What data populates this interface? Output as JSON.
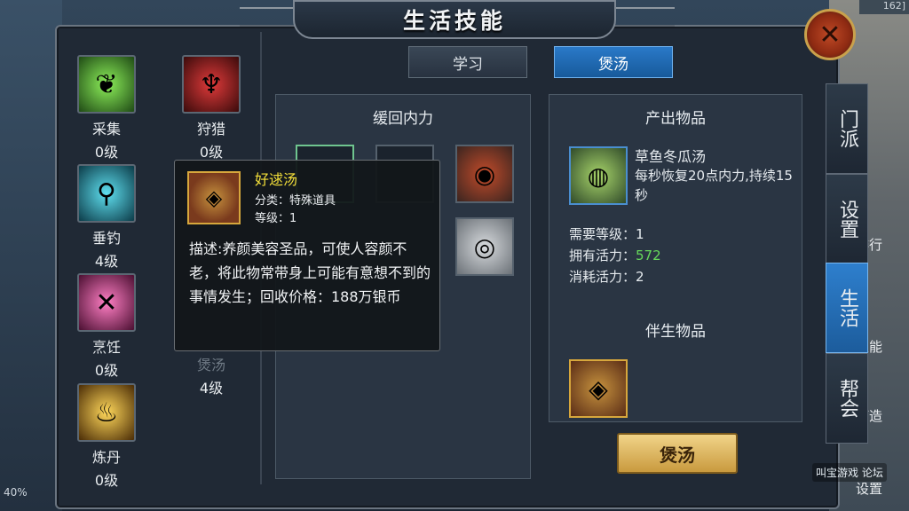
{
  "window": {
    "title": "生活技能"
  },
  "top_right_tag": "162]",
  "skills": [
    {
      "name": "采集",
      "level": "0级",
      "icon": "harvest-icon",
      "color": "#6fd23c"
    },
    {
      "name": "狩猎",
      "level": "0级",
      "icon": "deer-antler-icon",
      "color": "#d2262b"
    },
    {
      "name": "垂钓",
      "level": "4级",
      "icon": "fishing-icon",
      "color": "#2fc0d6"
    },
    {
      "name": "烹饪",
      "level": "0级",
      "icon": "cooking-utensils-icon",
      "color": "#e34f9e"
    },
    {
      "name": "炼丹",
      "level": "0级",
      "icon": "alchemy-cauldron-icon",
      "color": "#e2ad2c"
    },
    {
      "name": "煲汤",
      "level": "4级",
      "icon": "soup-pot-icon",
      "color": "#4f6e8d"
    }
  ],
  "tabs": [
    {
      "label": "学习"
    },
    {
      "label": "煲汤"
    }
  ],
  "recipe_panel": {
    "title": "缓回内力"
  },
  "product": {
    "header": "产出物品",
    "name": "草鱼冬瓜汤",
    "effect": "每秒恢复20点内力,持续15秒",
    "required_level_label": "需要等级：",
    "required_level": "1",
    "owned_vitality_label": "拥有活力：",
    "owned_vitality": "572",
    "cost_vitality_label": "消耗活力：",
    "cost_vitality": "2",
    "by_product_header": "伴生物品"
  },
  "action_button": {
    "label": "煲汤"
  },
  "side_tabs": [
    {
      "label": "门派"
    },
    {
      "label": "设置"
    },
    {
      "label": "生活"
    },
    {
      "label": "帮会"
    }
  ],
  "tooltip": {
    "name": "好逑汤",
    "category": "分类：特殊道具",
    "level": "等级：1",
    "description": "描述:养颜美容圣品，可使人容颜不老，将此物常带身上可能有意想不到的事情发生；回收价格：188万银币"
  },
  "overlay_texts": {
    "percent": "40%",
    "watermark": "叫宝游戏 论坛",
    "rank": "排行",
    "skill": "技能",
    "forge": "打造",
    "settings": "设置"
  },
  "colors": {
    "active_tab": "#1e67b0",
    "gold_button": "#d8ad55",
    "vitality_green": "#66d85b",
    "tooltip_name": "#f4e03a"
  }
}
